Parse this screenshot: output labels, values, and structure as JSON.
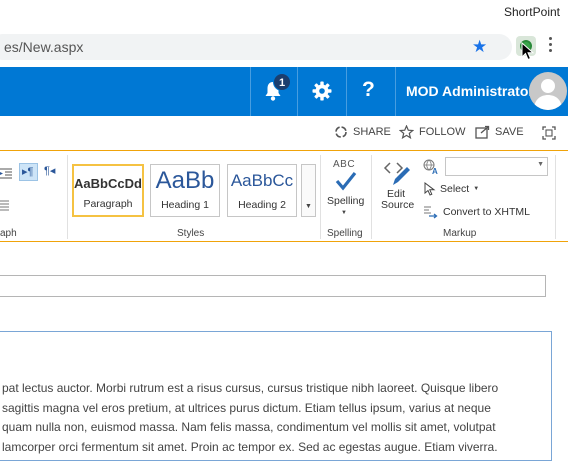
{
  "browser": {
    "app_title": "ShortPoint",
    "url": "es/New.aspx"
  },
  "suitebar": {
    "notification_count": "1",
    "help_label": "?",
    "user_name": "MOD Administrator"
  },
  "page_actions": {
    "share": "SHARE",
    "follow": "FOLLOW",
    "save": "SAVE"
  },
  "ribbon": {
    "paragraph_group_label": "aph",
    "styles": [
      {
        "sample": "AaBbCcDdE",
        "caption": "Paragraph"
      },
      {
        "sample": "AaBb",
        "caption": "Heading 1"
      },
      {
        "sample": "AaBbCc",
        "caption": "Heading 2"
      }
    ],
    "styles_group_label": "Styles",
    "spelling": {
      "abc": "ABC",
      "label": "Spelling",
      "group_label": "Spelling"
    },
    "markup": {
      "edit_source_line1": "Edit",
      "edit_source_line2": "Source",
      "select_label": "Select",
      "convert_label": "Convert to XHTML",
      "group_label": "Markup",
      "language_value": ""
    }
  },
  "editor": {
    "title_value": "",
    "lines": [
      "pat lectus auctor. Morbi rutrum est a risus cursus, cursus tristique nibh laoreet. Quisque libero",
      " sagittis magna vel eros pretium, at ultrices purus dictum. Etiam tellus ipsum, varius at neque",
      "quam nulla non, euismod massa. Nam felis massa, condimentum vel mollis sit amet, volutpat",
      "lamcorper orci fermentum sit amet. Proin ac tempor ex. Sed ac egestas augue. Etiam viverra."
    ]
  },
  "colors": {
    "suitebar": "#0078d4",
    "ribbon_accent": "#f0a30a",
    "style_blue": "#2b579a"
  }
}
